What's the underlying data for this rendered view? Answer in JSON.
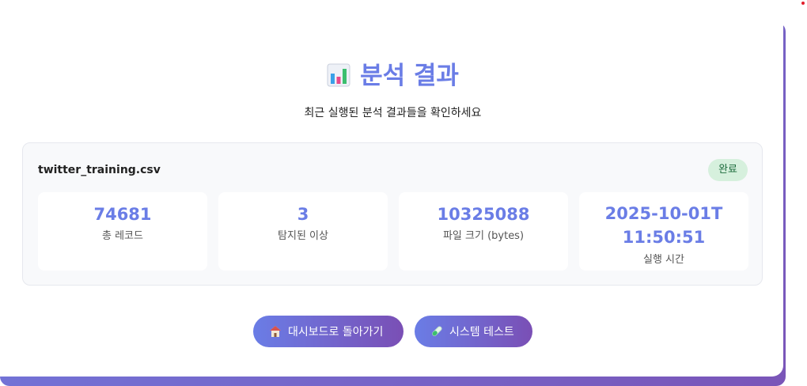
{
  "header": {
    "title": "분석 결과",
    "title_icon": "bar-chart-icon",
    "subtitle": "최근 실행된 분석 결과들을 확인하세요"
  },
  "result": {
    "file_name": "twitter_training.csv",
    "status": "완료",
    "stats": [
      {
        "value": "74681",
        "label": "총 레코드"
      },
      {
        "value": "3",
        "label": "탐지된 이상"
      },
      {
        "value": "10325088",
        "label": "파일 크기 (bytes)"
      },
      {
        "value": "2025-10-01T11:50:51",
        "label": "실행 시간"
      }
    ]
  },
  "actions": {
    "dashboard_label": "대시보드로 돌아가기",
    "dashboard_icon": "home-icon",
    "test_label": "시스템 테스트",
    "test_icon": "test-tube-icon"
  },
  "colors": {
    "accent": "#6a7de6",
    "accent_end": "#7a4fb5",
    "status_bg": "#d6f0dd",
    "status_text": "#1c6b3c"
  }
}
